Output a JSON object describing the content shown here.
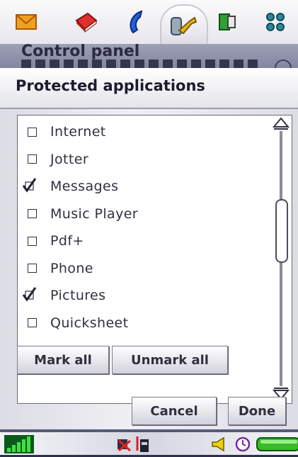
{
  "appbar": {
    "icons": [
      "envelope-icon",
      "book-icon",
      "phone-icon",
      "control-panel-icon",
      "media-icon",
      "apps-grid-icon"
    ],
    "active_index": 3
  },
  "background": {
    "title": "Control panel"
  },
  "dialog": {
    "title": "Protected applications",
    "items": [
      {
        "label": "Internet",
        "checked": false
      },
      {
        "label": "Jotter",
        "checked": false
      },
      {
        "label": "Messages",
        "checked": true
      },
      {
        "label": "Music Player",
        "checked": false
      },
      {
        "label": "Pdf+",
        "checked": false
      },
      {
        "label": "Phone",
        "checked": false
      },
      {
        "label": "Pictures",
        "checked": true
      },
      {
        "label": "Quicksheet",
        "checked": false
      }
    ],
    "mark_all_label": "Mark all",
    "unmark_all_label": "Unmark all",
    "cancel_label": "Cancel",
    "done_label": "Done"
  },
  "statusbar": {
    "icons": [
      "signal-icon",
      "no-network-icon",
      "battery-small-icon",
      "volume-icon",
      "alarm-clock-icon",
      "battery-icon"
    ]
  },
  "colors": {
    "accent": "#8486a2",
    "signal": "#1a9a2a",
    "battery": "#3cb82a"
  }
}
